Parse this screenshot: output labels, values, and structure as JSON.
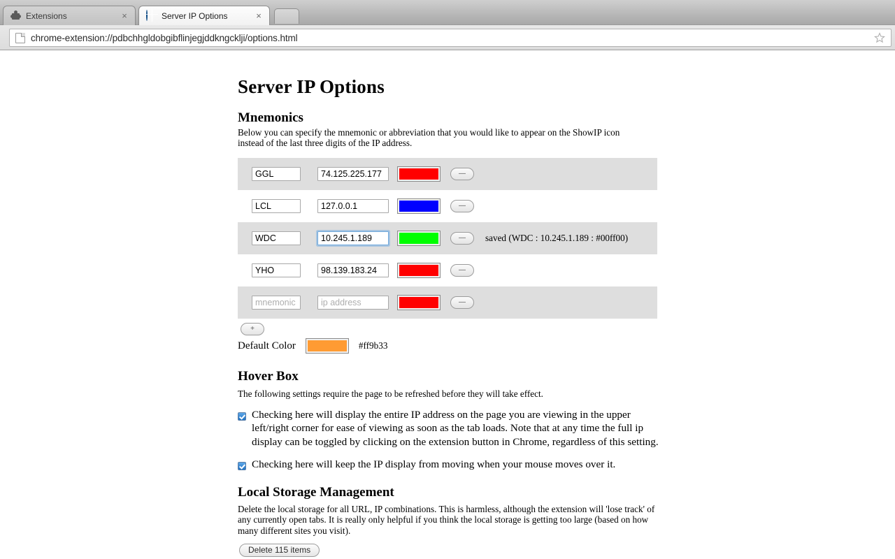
{
  "browser": {
    "tabs": [
      {
        "title": "Extensions",
        "favicon": "puzzle-icon",
        "close_label": "×",
        "active": false
      },
      {
        "title": "Server IP Options",
        "favicon": "globe-icon",
        "close_label": "×",
        "active": true
      }
    ],
    "new_tab_label": "",
    "omnibox": {
      "url": "chrome-extension://pdbchhgldobgibflinjegjddkngcklji/options.html",
      "page_icon": "page-icon",
      "bookmark_icon": "star-icon"
    }
  },
  "page": {
    "title": "Server IP Options",
    "mnemonics": {
      "heading": "Mnemonics",
      "description": "Below you can specify the mnemonic or abbreviation that you would like to appear on the ShowIP icon instead of the last three digits of the IP address.",
      "name_placeholder": "mnemonic",
      "ip_placeholder": "ip address",
      "remove_label": "—",
      "add_label": "+",
      "rows": [
        {
          "name": "GGL",
          "ip": "74.125.225.177",
          "color": "#ff0000",
          "shaded": true,
          "focused": false,
          "status": ""
        },
        {
          "name": "LCL",
          "ip": "127.0.0.1",
          "color": "#0000ff",
          "shaded": false,
          "focused": false,
          "status": ""
        },
        {
          "name": "WDC",
          "ip": "10.245.1.189",
          "color": "#00ff00",
          "shaded": true,
          "focused": true,
          "status": "saved (WDC : 10.245.1.189 : #00ff00)"
        },
        {
          "name": "YHO",
          "ip": "98.139.183.24",
          "color": "#ff0000",
          "shaded": false,
          "focused": false,
          "status": ""
        },
        {
          "name": "",
          "ip": "",
          "color": "#ff0000",
          "shaded": true,
          "focused": false,
          "status": ""
        }
      ],
      "default_color": {
        "label": "Default Color",
        "hex": "#ff9b33"
      }
    },
    "hover_box": {
      "heading": "Hover Box",
      "description": "The following settings require the page to be refreshed before they will take effect.",
      "checkboxes": [
        {
          "checked": true,
          "label": "Checking here will display the entire IP address on the page you are viewing in the upper left/right corner for ease of viewing as soon as the tab loads. Note that at any time the full ip display can be toggled by clicking on the extension button in Chrome, regardless of this setting."
        },
        {
          "checked": true,
          "label": "Checking here will keep the IP display from moving when your mouse moves over it."
        }
      ]
    },
    "local_storage": {
      "heading": "Local Storage Management",
      "description": "Delete the local storage for all URL, IP combinations. This is harmless, although the extension will 'lose track' of any currently open tabs. It is really only helpful if you think the local storage is getting too large (based on how many different sites you visit).",
      "delete_label": "Delete 115 items"
    }
  }
}
